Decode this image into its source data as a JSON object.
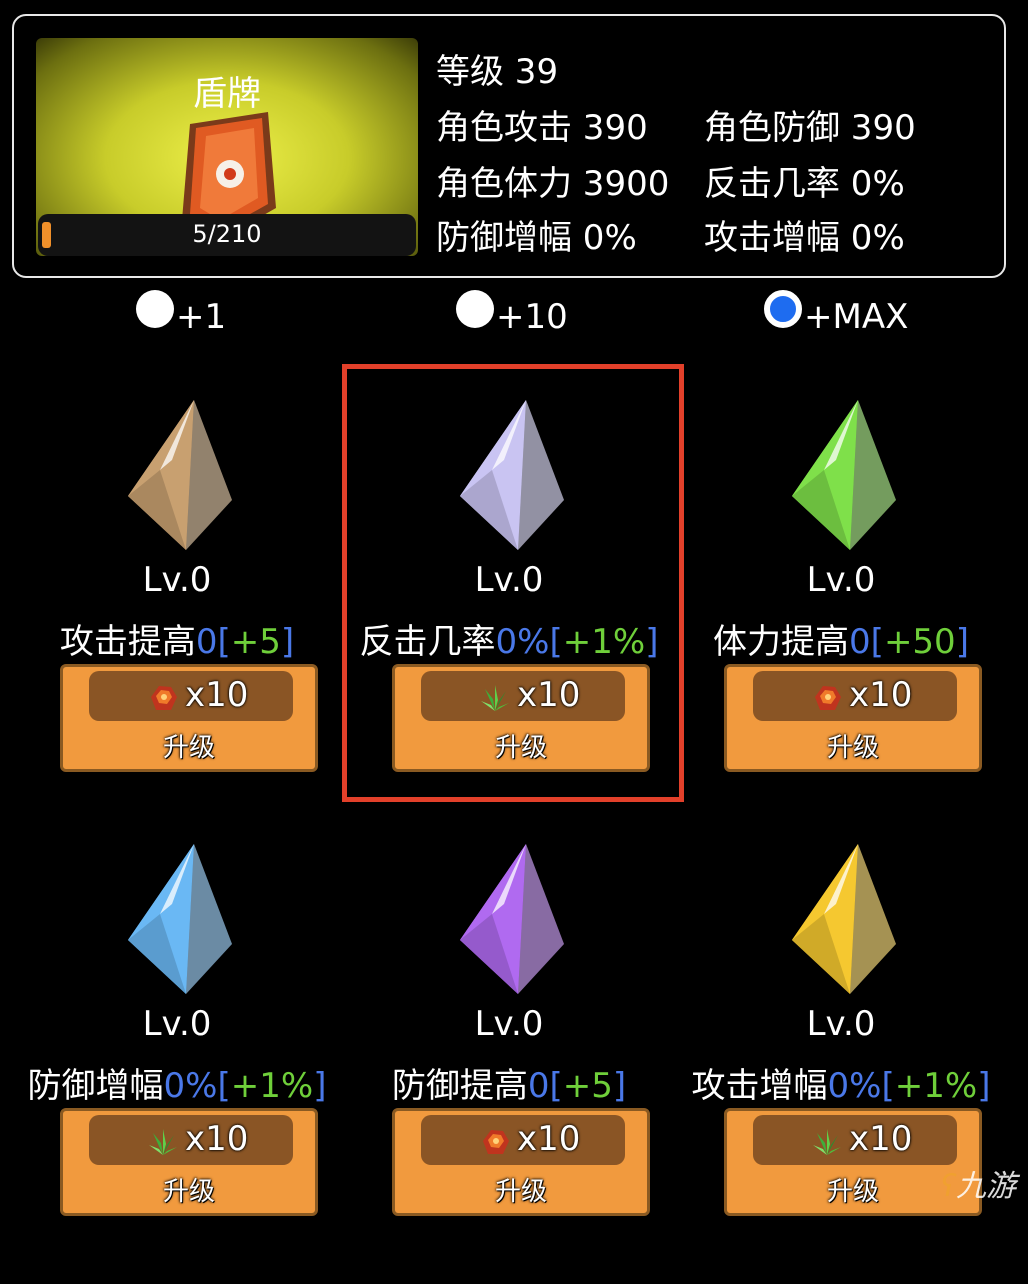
{
  "item": {
    "name": "盾牌",
    "exp_text": "5/210",
    "exp_progress": 0.024
  },
  "stats": {
    "level": "等级 39",
    "attack": "角色攻击 390",
    "defense": "角色防御 390",
    "stamina": "角色体力 3900",
    "counter_rate": "反击几率 0%",
    "defense_boost": "防御增幅 0%",
    "attack_boost": "攻击增幅 0%"
  },
  "radio_options": [
    {
      "label": "+1",
      "selected": false
    },
    {
      "label": "+10",
      "selected": false
    },
    {
      "label": "+MAX",
      "selected": true
    }
  ],
  "upgrades": [
    {
      "gem": "brown-gem-icon",
      "level": "Lv.0",
      "stat": "攻击提高",
      "current": "0",
      "bonus": "+5",
      "material": "ore-icon",
      "cost": "x10",
      "button": "升级",
      "gem_color": "#c8a070"
    },
    {
      "gem": "lavender-gem-icon",
      "level": "Lv.0",
      "stat": "反击几率",
      "current": "0%",
      "bonus": "+1%",
      "material": "herb-icon",
      "cost": "x10",
      "button": "升级",
      "gem_color": "#c9c4f2"
    },
    {
      "gem": "green-gem-icon",
      "level": "Lv.0",
      "stat": "体力提高",
      "current": "0",
      "bonus": "+50",
      "material": "ore-icon",
      "cost": "x10",
      "button": "升级",
      "gem_color": "#7fe04a"
    },
    {
      "gem": "blue-gem-icon",
      "level": "Lv.0",
      "stat": "防御增幅",
      "current": "0%",
      "bonus": "+1%",
      "material": "herb-icon",
      "cost": "x10",
      "button": "升级",
      "gem_color": "#6ab8f4"
    },
    {
      "gem": "purple-gem-icon",
      "level": "Lv.0",
      "stat": "防御提高",
      "current": "0",
      "bonus": "+5",
      "material": "ore-icon",
      "cost": "x10",
      "button": "升级",
      "gem_color": "#b06af0"
    },
    {
      "gem": "yellow-gem-icon",
      "level": "Lv.0",
      "stat": "攻击增幅",
      "current": "0%",
      "bonus": "+1%",
      "material": "herb-icon",
      "cost": "x10",
      "button": "升级",
      "gem_color": "#f5c830"
    }
  ],
  "watermark": "九游",
  "colors": {
    "accent_blue": "#4a78e8",
    "bonus_green": "#6fcf3a",
    "button_orange": "#f19a3e",
    "highlight_red": "#e2402a"
  }
}
